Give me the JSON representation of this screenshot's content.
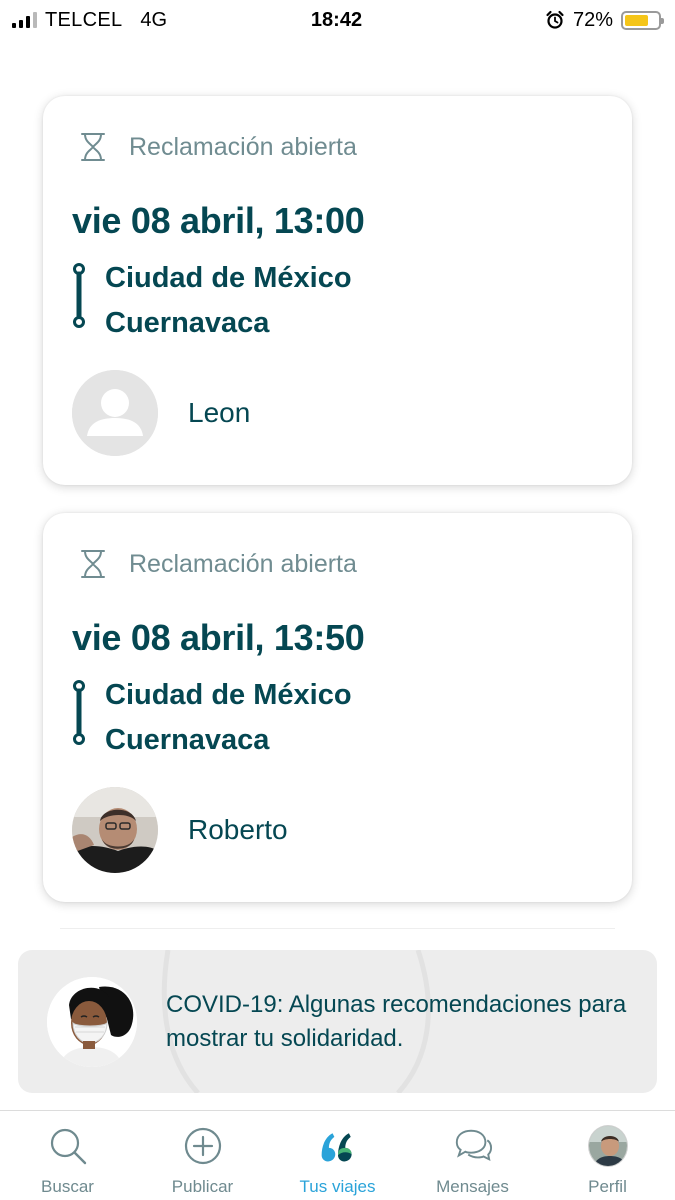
{
  "status_bar": {
    "carrier": "TELCEL",
    "network": "4G",
    "time": "18:42",
    "battery": "72%",
    "battery_level": 0.72
  },
  "trips": [
    {
      "status": "Reclamación abierta",
      "date": "vie 08 abril, 13:00",
      "from": "Ciudad de México",
      "to": "Cuernavaca",
      "driver": "Leon",
      "avatar": "default-avatar-icon"
    },
    {
      "status": "Reclamación abierta",
      "date": "vie 08 abril, 13:50",
      "from": "Ciudad de México",
      "to": "Cuernavaca",
      "driver": "Roberto",
      "avatar": "driver-photo"
    }
  ],
  "covid_banner": {
    "text": "COVID-19: Algunas recomendaciones para mostrar tu solidaridad."
  },
  "tab_bar": {
    "tabs": [
      {
        "label": "Buscar",
        "icon": "search-icon",
        "active": false
      },
      {
        "label": "Publicar",
        "icon": "plus-circle-icon",
        "active": false
      },
      {
        "label": "Tus viajes",
        "icon": "rides-icon",
        "active": true
      },
      {
        "label": "Mensajes",
        "icon": "chat-bubbles-icon",
        "active": false
      },
      {
        "label": "Perfil",
        "icon": "profile-avatar-icon",
        "active": false
      }
    ]
  },
  "colors": {
    "primary_text": "#054752",
    "secondary_text": "#708c91",
    "active_tab": "#2aa3d9",
    "battery": "#f5c518"
  }
}
